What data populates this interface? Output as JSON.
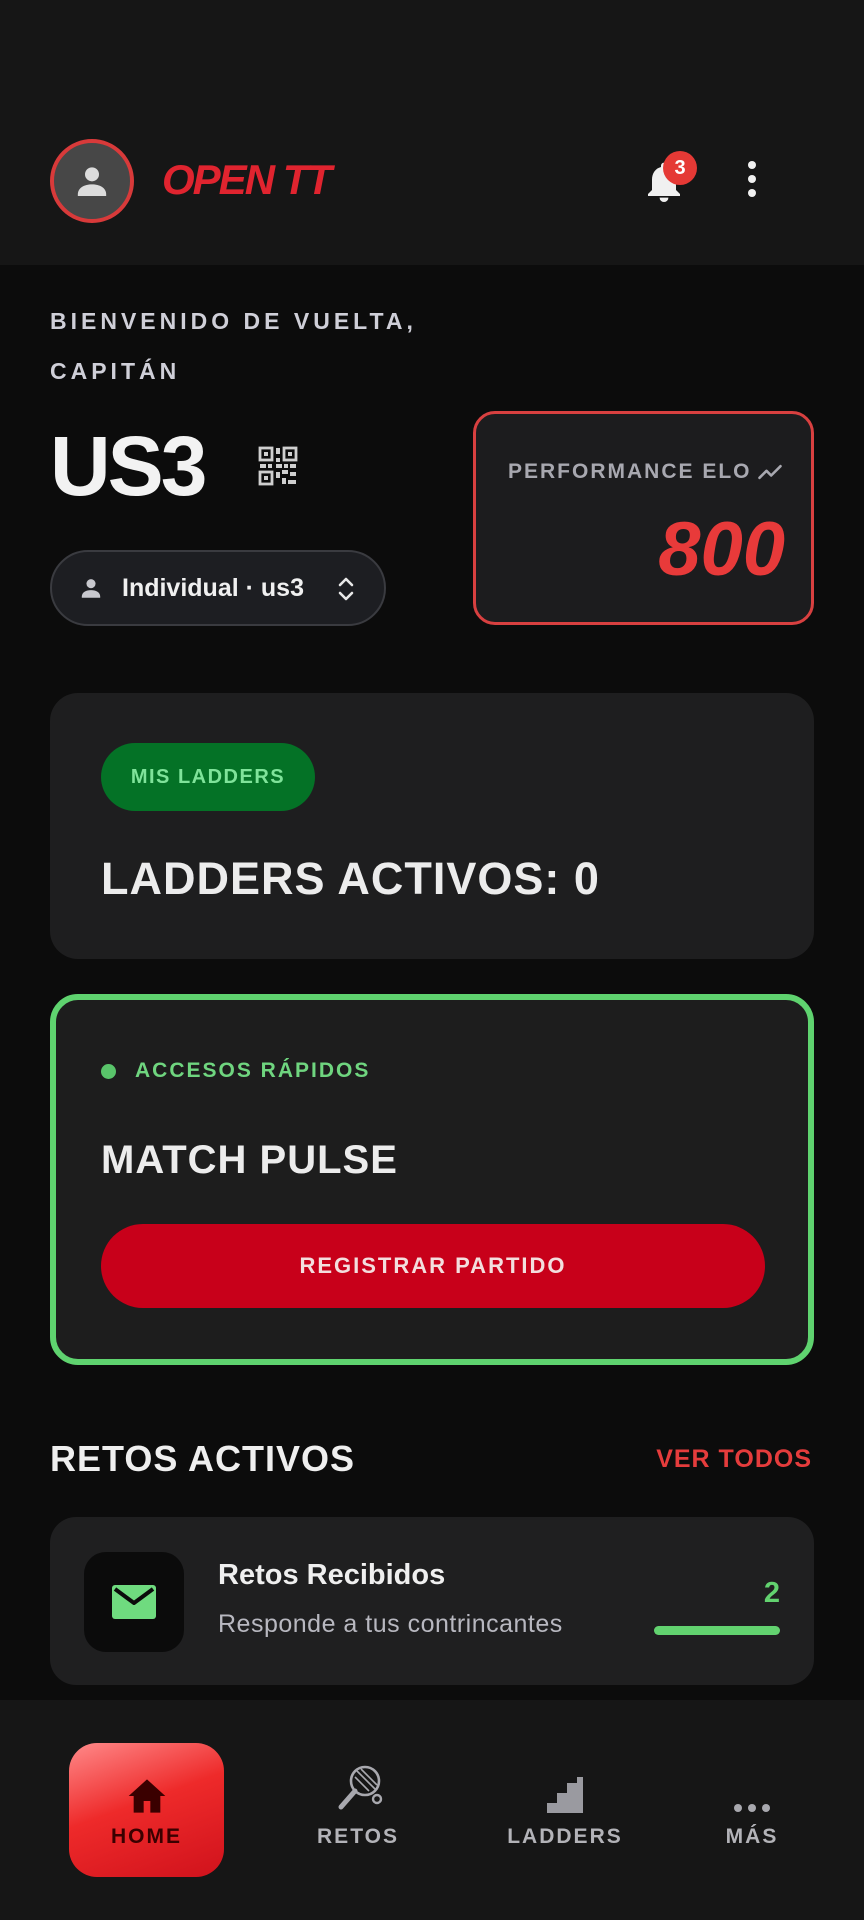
{
  "header": {
    "app_title": "OPEN TT",
    "notification_count": "3"
  },
  "welcome": {
    "line1": "BIENVENIDO DE VUELTA,",
    "line2": "CAPITÁN"
  },
  "user": {
    "name": "US3",
    "profile_selector": "Individual · us3"
  },
  "elo": {
    "label": "PERFORMANCE ELO",
    "value": "800"
  },
  "ladders": {
    "chip": "MIS LADDERS",
    "count_text": "LADDERS ACTIVOS: 0"
  },
  "quick_access": {
    "label": "ACCESOS RÁPIDOS",
    "title": "MATCH PULSE",
    "button": "REGISTRAR PARTIDO"
  },
  "retos": {
    "section_title": "RETOS ACTIVOS",
    "see_all": "VER TODOS",
    "card": {
      "title": "Retos Recibidos",
      "subtitle": "Responde a tus contrincantes",
      "count": "2",
      "progress": 1.0
    }
  },
  "nav": {
    "home": "HOME",
    "retos": "RETOS",
    "ladders": "LADDERS",
    "mas": "MÁS",
    "active": "home"
  },
  "icons": {
    "avatar": "person-icon",
    "notifications": "bell-icon",
    "menu": "kebab-menu-icon",
    "qr": "qr-code-icon",
    "profile": "person-icon",
    "selector": "unfold-icon",
    "elo_trend": "trending-icon",
    "retos_card": "mail-icon",
    "nav_home": "home-icon",
    "nav_retos": "paddle-icon",
    "nav_ladders": "stairs-icon",
    "nav_mas": "more-icon"
  },
  "colors": {
    "accent_red": "#e53935",
    "accent_green": "#62d26f",
    "background": "#0c0c0c",
    "card": "#1e1e1f"
  }
}
